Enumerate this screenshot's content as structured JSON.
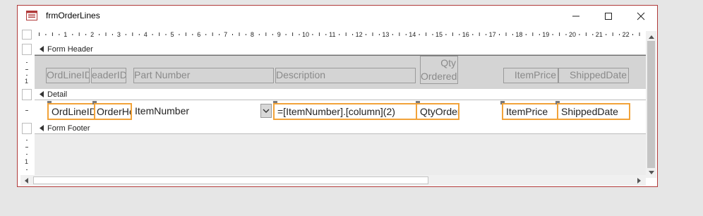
{
  "window": {
    "title": "frmOrderLines"
  },
  "ruler": {
    "numbers": [
      "1",
      "2",
      "3",
      "4",
      "5",
      "6",
      "7",
      "8",
      "9",
      "10",
      "11",
      "12",
      "13",
      "14",
      "15",
      "16",
      "17",
      "18",
      "19",
      "20",
      "21",
      "22"
    ]
  },
  "vruler": {
    "marks": [
      "1"
    ]
  },
  "sections": {
    "form_header": "Form Header",
    "detail": "Detail",
    "form_footer": "Form Footer"
  },
  "header_labels": {
    "ordlineid": "OrdLineID",
    "orderheaderid": "eaderID",
    "part_number": "Part Number",
    "description": "Description",
    "qty_line1": "Qty",
    "qty_line2": "Ordered",
    "itemprice": "ItemPrice",
    "shippeddate": "ShippedDate"
  },
  "detail_controls": {
    "ordlineid": "OrdLineID",
    "orderheaderid": "OrderHe",
    "itemnumber": "ItemNumber",
    "description_expr": "=[ItemNumber].[column](2)",
    "qtyordered": "QtyOrder",
    "itemprice": "ItemPrice",
    "shippeddate": "ShippedDate"
  },
  "colors": {
    "selection": "#f2a33a",
    "window_border": "#b03a3a"
  }
}
